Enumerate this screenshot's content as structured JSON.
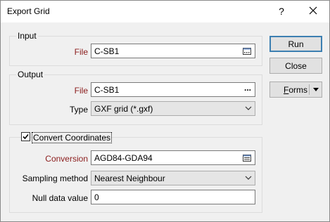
{
  "window": {
    "title": "Export Grid",
    "help_label": "?",
    "close_icon": "close-icon"
  },
  "input_group": {
    "legend": "Input",
    "file_label": "File",
    "file_value": "C-SB1",
    "file_browse_icon": "browse-icon"
  },
  "output_group": {
    "legend": "Output",
    "file_label": "File",
    "file_value": "C-SB1",
    "file_browse_label": "...",
    "type_label": "Type",
    "type_value": "GXF grid (*.gxf)"
  },
  "coords_group": {
    "checkbox_label": "Convert Coordinates",
    "checked": true,
    "conversion_label": "Conversion",
    "conversion_value": "AGD84-GDA94",
    "conversion_icon": "list-icon",
    "sampling_label": "Sampling method",
    "sampling_value": "Nearest Neighbour",
    "null_label": "Null data value",
    "null_value": "0"
  },
  "buttons": {
    "run": "Run",
    "close": "Close",
    "forms_prefix": "",
    "forms_underlined": "F",
    "forms_rest": "orms"
  },
  "colors": {
    "required_label": "#8b1c1c",
    "default_button_border": "#3c7fb1"
  }
}
